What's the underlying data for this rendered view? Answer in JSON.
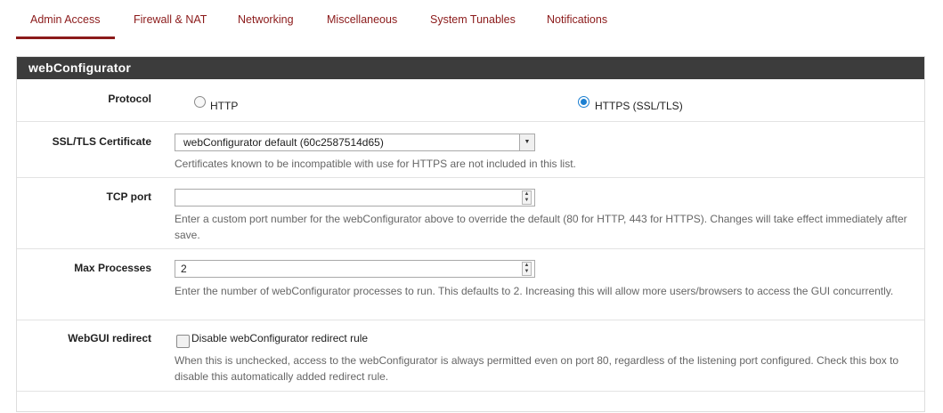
{
  "tabs": [
    {
      "label": "Admin Access",
      "active": true
    },
    {
      "label": "Firewall & NAT",
      "active": false
    },
    {
      "label": "Networking",
      "active": false
    },
    {
      "label": "Miscellaneous",
      "active": false
    },
    {
      "label": "System Tunables",
      "active": false
    },
    {
      "label": "Notifications",
      "active": false
    }
  ],
  "panel": {
    "title": "webConfigurator"
  },
  "protocol": {
    "label": "Protocol",
    "options": [
      {
        "label": "HTTP",
        "checked": false
      },
      {
        "label": "HTTPS (SSL/TLS)",
        "checked": true
      }
    ]
  },
  "certificate": {
    "label": "SSL/TLS Certificate",
    "selected": "webConfigurator default (60c2587514d65)",
    "help": "Certificates known to be incompatible with use for HTTPS are not included in this list."
  },
  "tcp_port": {
    "label": "TCP port",
    "value": "",
    "help": "Enter a custom port number for the webConfigurator above to override the default (80 for HTTP, 443 for HTTPS). Changes will take effect immediately after save."
  },
  "max_processes": {
    "label": "Max Processes",
    "value": "2",
    "help": "Enter the number of webConfigurator processes to run. This defaults to 2. Increasing this will allow more users/browsers to access the GUI concurrently."
  },
  "webgui_redirect": {
    "label": "WebGUI redirect",
    "checkbox_label": "Disable webConfigurator redirect rule",
    "checked": false,
    "help": "When this is unchecked, access to the webConfigurator is always permitted even on port 80, regardless of the listening port configured. Check this box to disable this automatically added redirect rule."
  },
  "colors": {
    "accent": "#8b1a1a",
    "heading_bg": "#3c3c3c",
    "radio_checked": "#1b7fd1"
  },
  "icons": {
    "select_arrow": "triangle-down-icon",
    "spin_up": "triangle-up-icon",
    "spin_down": "triangle-down-icon"
  }
}
